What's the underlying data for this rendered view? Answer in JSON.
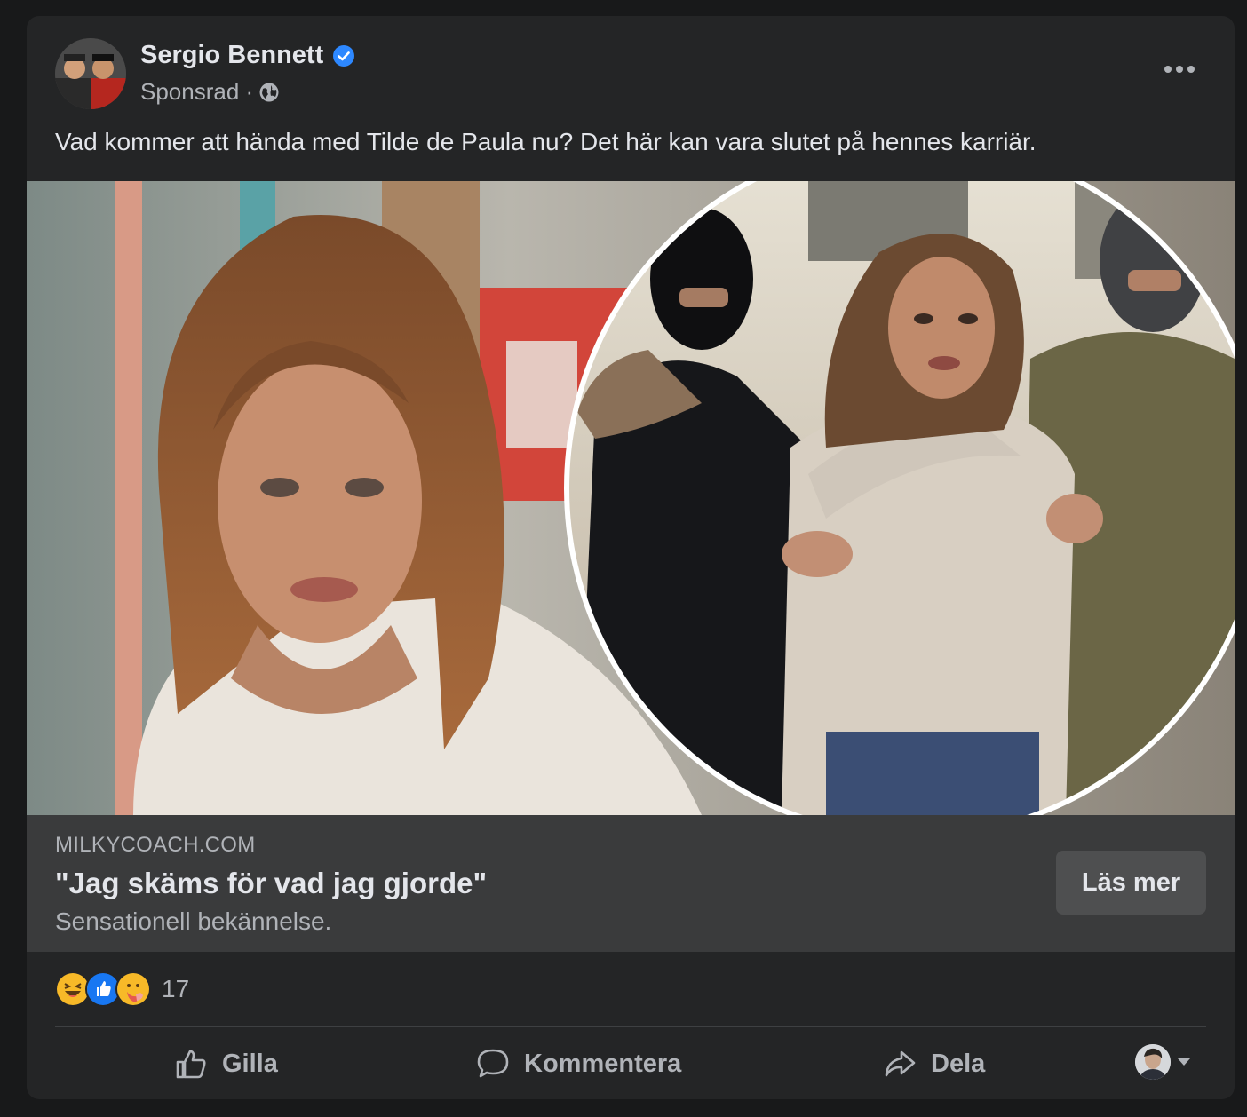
{
  "post": {
    "author": "Sergio Bennett",
    "sponsored_label": "Sponsrad ·",
    "caption": "Vad kommer att hända med Tilde de Paula nu? Det här kan vara slutet på hennes karriär.",
    "more_icon": "more-horizontal-icon"
  },
  "link_preview": {
    "domain": "MILKYCOACH.COM",
    "headline": "\"Jag skäms för vad jag gjorde\"",
    "subtitle": "Sensationell bekännelse.",
    "cta_label": "Läs mer"
  },
  "reactions": {
    "icons": [
      "laugh-reaction-icon",
      "like-reaction-icon",
      "care-reaction-icon"
    ],
    "count": "17"
  },
  "actions": {
    "like_label": "Gilla",
    "comment_label": "Kommentera",
    "share_label": "Dela"
  },
  "colors": {
    "card_bg": "#242526",
    "page_bg": "#18191a",
    "verified_blue": "#2d88ff",
    "like_blue": "#1877f2",
    "laugh_yellow": "#f7b928"
  }
}
